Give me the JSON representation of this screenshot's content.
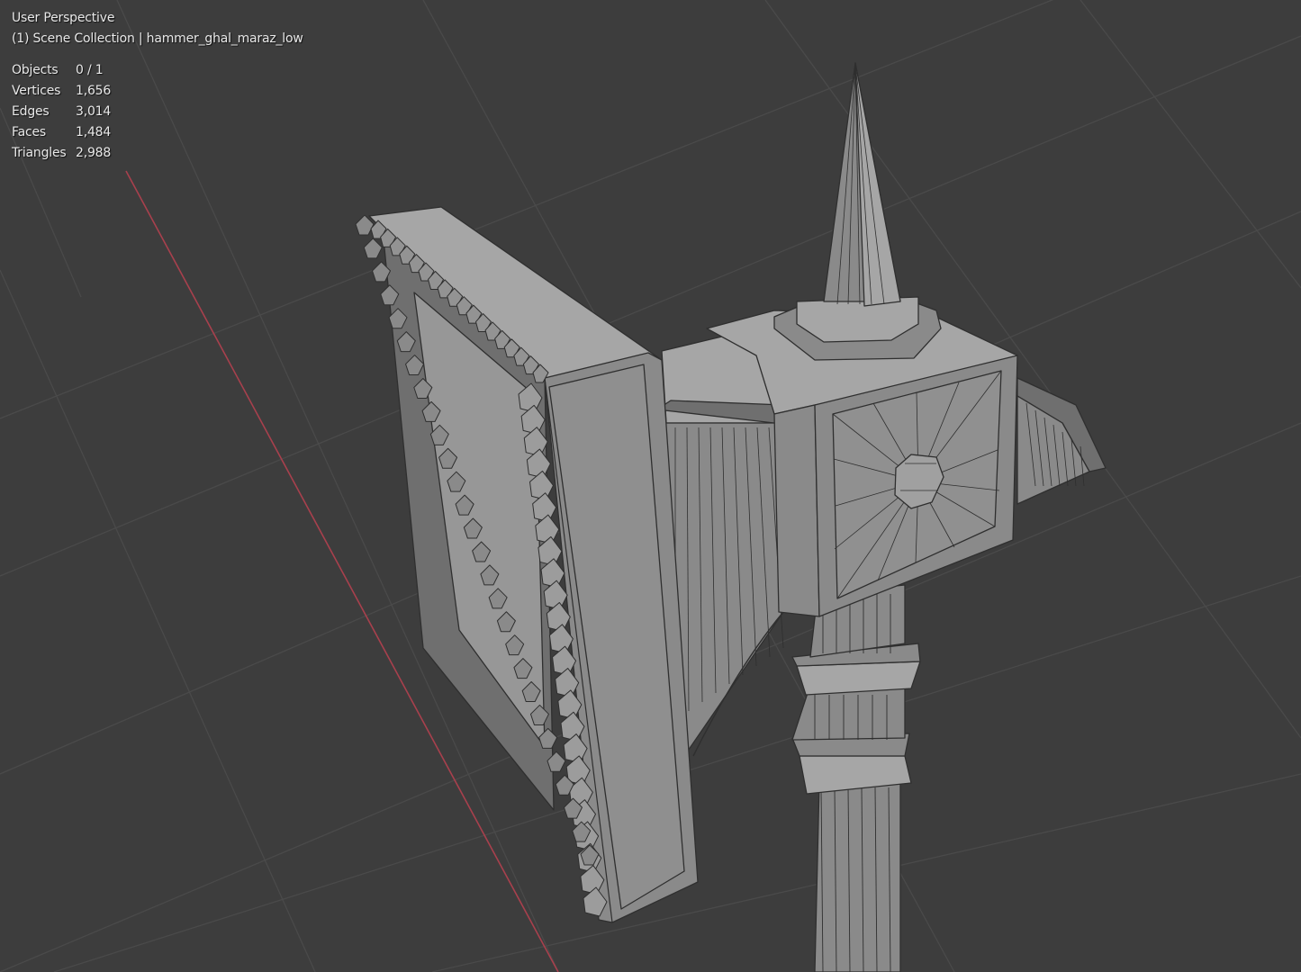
{
  "viewport": {
    "view_name": "User Perspective",
    "collection_line": "(1) Scene Collection | hammer_ghal_maraz_low",
    "stats": [
      {
        "label": "Objects",
        "value": "0 / 1"
      },
      {
        "label": "Vertices",
        "value": "1,656"
      },
      {
        "label": "Edges",
        "value": "3,014"
      },
      {
        "label": "Faces",
        "value": "1,484"
      },
      {
        "label": "Triangles",
        "value": "2,988"
      }
    ]
  },
  "colors": {
    "background": "#3d3d3d",
    "grid_line": "#4a4a4a",
    "x_axis": "#a8404d",
    "mesh_face": "#8a8a8a",
    "mesh_face_light": "#a6a6a6",
    "mesh_face_dark": "#6f6f6f",
    "wire": "#2f2f2f",
    "overlay_text": "#e8e8e8"
  },
  "icons": [
    "viewport-grid",
    "x-axis-line",
    "hammer-mesh"
  ]
}
